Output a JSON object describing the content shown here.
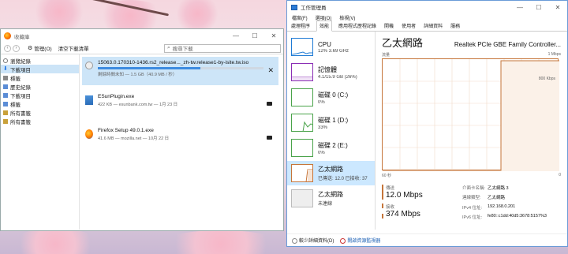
{
  "library": {
    "title": "收藏庫",
    "toolbar": {
      "manage": "管理(O)",
      "clear": "清空下載清單",
      "search_placeholder": "搜尋下載"
    },
    "sidebar": [
      {
        "label": "瀏覽紀錄",
        "selected": false
      },
      {
        "label": "下載項目",
        "selected": true
      },
      {
        "label": "標籤",
        "selected": false
      },
      {
        "label": "歷史紀錄",
        "selected": false
      },
      {
        "label": "下載項目",
        "selected": false
      },
      {
        "label": "標籤",
        "selected": false
      },
      {
        "label": "所有書籤",
        "selected": false
      },
      {
        "label": "所有書籤",
        "selected": false
      }
    ],
    "downloads": [
      {
        "name": "15063.0.170310-1436.rs2_release..._zh-tw.release1-by-isite.tw.iso",
        "meta": "剩餘時間未知 — 1.5 GB（40.9 MB / 秒）",
        "progress": 0.62,
        "action": "✕"
      },
      {
        "name": "ESunPlugin.exe",
        "meta": "422 KB — esunbank.com.tw — 1月 23 日"
      },
      {
        "name": "Firefox Setup 49.0.1.exe",
        "meta": "41.6 MB — mozilla.net — 10月 22 日"
      }
    ]
  },
  "taskmgr": {
    "title": "工作管理員",
    "menu": [
      "檔案(F)",
      "選項(O)",
      "檢視(V)"
    ],
    "tabs": [
      "處理程序",
      "效能",
      "應用程式歷程記錄",
      "開機",
      "使用者",
      "詳細資料",
      "服務"
    ],
    "active_tab": 1,
    "perf_items": [
      {
        "name": "CPU",
        "sub": "12%  3.69 GHz",
        "color": "#1f7bd5"
      },
      {
        "name": "記憶體",
        "sub": "4.1/15.9 GB (26%)",
        "color": "#8b2fb5"
      },
      {
        "name": "磁碟 0 (C:)",
        "sub": "0%",
        "color": "#4aa34a"
      },
      {
        "name": "磁碟 1 (D:)",
        "sub": "33%",
        "color": "#4aa34a"
      },
      {
        "name": "磁碟 2 (E:)",
        "sub": "0%",
        "color": "#4aa34a"
      },
      {
        "name": "乙太網路",
        "sub": "已傳送: 12.0  已接收: 37",
        "color": "#c6753a"
      },
      {
        "name": "乙太網路",
        "sub": "未連線",
        "color": "#999999"
      }
    ],
    "detail": {
      "title": "乙太網路",
      "adapter": "Realtek PCIe GBE Family Controller...",
      "graph_label": "流量",
      "graph_max": "1 Mbps",
      "graph_mid": "800 Kbps",
      "graph_time": "60 秒",
      "graph_zero": "0",
      "send_label": "傳送",
      "send_value": "12.0 Mbps",
      "recv_label": "接收",
      "recv_value": "374 Mbps",
      "props": [
        {
          "k": "介面卡名稱:",
          "v": "乙太網路 3"
        },
        {
          "k": "連線類型:",
          "v": "乙太網路"
        },
        {
          "k": "IPv4 位址:",
          "v": "192.168.0.201"
        },
        {
          "k": "IPv6 位址:",
          "v": "fe80::c1dd:40d5:3678:5157%3"
        }
      ]
    },
    "footer": {
      "fewer": "較少詳細資料(D)",
      "open_monitor": "開啟資源監視器"
    }
  }
}
